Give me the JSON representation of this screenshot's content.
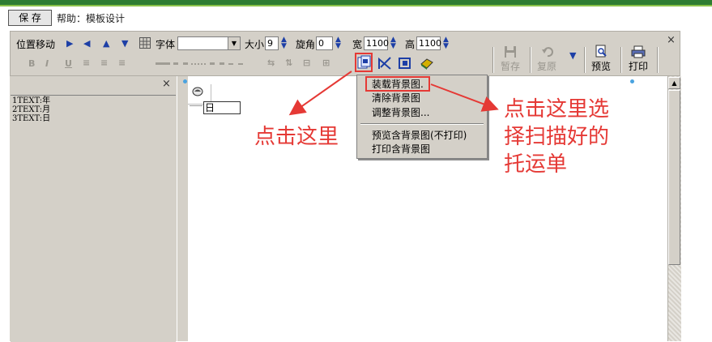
{
  "header": {
    "save_label": "保 存",
    "help_text": "帮助：模板设计"
  },
  "toolbar": {
    "position_move": "位置移动",
    "font_label": "字体",
    "font_value": "",
    "size_label": "大小",
    "size_value": "9",
    "rotation_label": "旋角",
    "rotation_value": "0",
    "width_label": "宽",
    "width_value": "1100",
    "height_label": "高",
    "height_value": "1100",
    "bold": "B",
    "italic": "I",
    "underline": "U",
    "temp_save_label": "暂存",
    "restore_label": "复原",
    "preview_label": "预览",
    "print_label": "打印",
    "close_glyph": "×"
  },
  "left_panel": {
    "close_glyph": "×",
    "items": [
      "1TEXT:年",
      "2TEXT:月",
      "3TEXT:日"
    ]
  },
  "canvas": {
    "field_text": "日"
  },
  "context_menu": {
    "items": [
      "装载背景图.",
      "清除背景图",
      "调整背景图...",
      "预览含背景图(不打印)",
      "打印含背景图"
    ]
  },
  "annotations": {
    "click_here": "点击这里",
    "click_select": [
      "点击这里选",
      "择扫描好的",
      "托运单"
    ]
  },
  "colors": {
    "accent_green": "#2e7d32",
    "annotation_red": "#e53935",
    "toolbar_gray": "#d4d0c8"
  }
}
